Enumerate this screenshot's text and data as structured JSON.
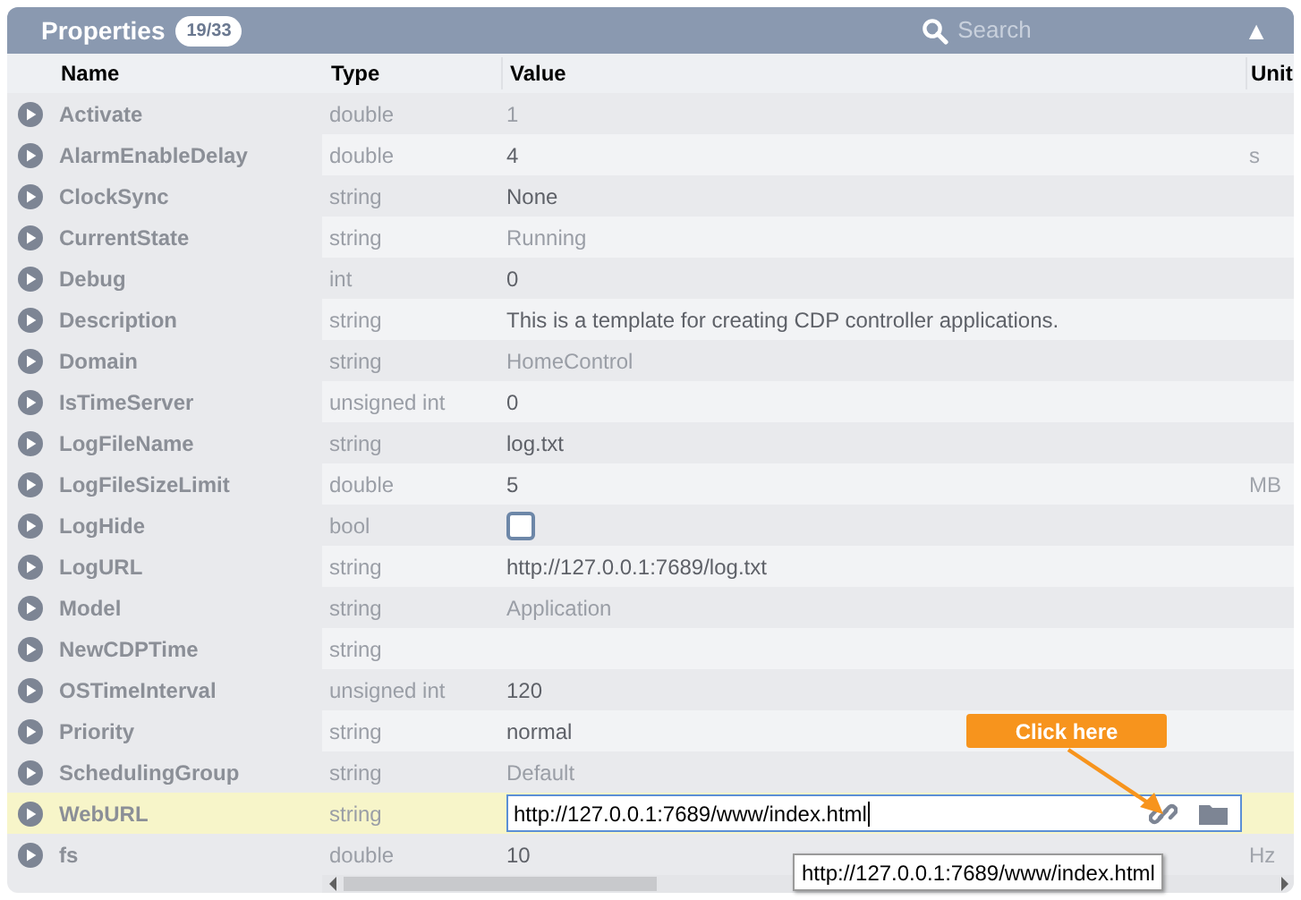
{
  "header": {
    "title": "Properties",
    "count": "19/33",
    "search_placeholder": "Search",
    "collapse_glyph": "▲"
  },
  "columns": [
    "Name",
    "Type",
    "Value",
    "Unit"
  ],
  "rows": [
    {
      "name": "Activate",
      "type": "double",
      "kind": "text",
      "value": "1",
      "readonly": true,
      "selected": false
    },
    {
      "name": "AlarmEnableDelay",
      "type": "double",
      "kind": "text",
      "value": "4",
      "unit": "s",
      "readonly": false,
      "selected": false
    },
    {
      "name": "ClockSync",
      "type": "string",
      "kind": "text",
      "value": "None",
      "readonly": false,
      "selected": false
    },
    {
      "name": "CurrentState",
      "type": "string",
      "kind": "text",
      "value": "Running",
      "readonly": true,
      "selected": false
    },
    {
      "name": "Debug",
      "type": "int",
      "kind": "text",
      "value": "0",
      "readonly": false,
      "selected": false
    },
    {
      "name": "Description",
      "type": "string",
      "kind": "text",
      "value": "This is a template for creating CDP controller applications.",
      "readonly": false,
      "selected": false
    },
    {
      "name": "Domain",
      "type": "string",
      "kind": "text",
      "value": "HomeControl",
      "readonly": true,
      "selected": false
    },
    {
      "name": "IsTimeServer",
      "type": "unsigned int",
      "kind": "text",
      "value": "0",
      "readonly": false,
      "selected": false
    },
    {
      "name": "LogFileName",
      "type": "string",
      "kind": "text",
      "value": "log.txt",
      "readonly": false,
      "selected": false
    },
    {
      "name": "LogFileSizeLimit",
      "type": "double",
      "kind": "text",
      "value": "5",
      "unit": "MB",
      "readonly": false,
      "selected": false
    },
    {
      "name": "LogHide",
      "type": "bool",
      "kind": "checkbox",
      "checked": false,
      "selected": false
    },
    {
      "name": "LogURL",
      "type": "string",
      "kind": "text",
      "value": "http://127.0.0.1:7689/log.txt",
      "readonly": false,
      "selected": false
    },
    {
      "name": "Model",
      "type": "string",
      "kind": "text",
      "value": "Application",
      "readonly": true,
      "selected": false
    },
    {
      "name": "NewCDPTime",
      "type": "string",
      "kind": "text",
      "selected": false
    },
    {
      "name": "OSTimeInterval",
      "type": "unsigned int",
      "kind": "text",
      "value": "120",
      "readonly": false,
      "selected": false
    },
    {
      "name": "Priority",
      "type": "string",
      "kind": "text",
      "value": "normal",
      "readonly": false,
      "selected": false
    },
    {
      "name": "SchedulingGroup",
      "type": "string",
      "kind": "text",
      "value": "Default",
      "readonly": true,
      "selected": false
    },
    {
      "name": "WebURL",
      "type": "string",
      "kind": "field",
      "value": "http://127.0.0.1:7689/www/index.html",
      "selected": true
    },
    {
      "name": "fs",
      "type": "double",
      "kind": "text",
      "value": "10",
      "unit": "Hz",
      "readonly": false,
      "selected": false
    }
  ],
  "callout": "Click here",
  "tooltip": "http://127.0.0.1:7689/www/index.html"
}
